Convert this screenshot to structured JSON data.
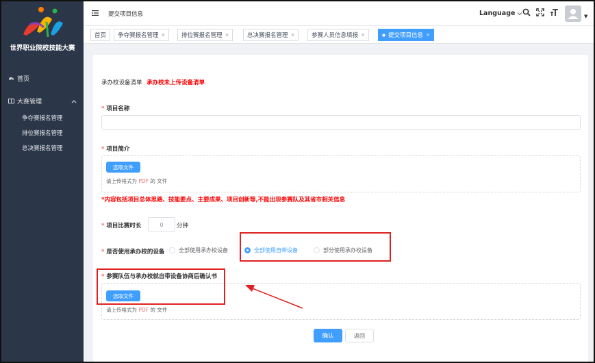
{
  "sidebar": {
    "logo_text": "世界职业院校技能大赛",
    "home_label": "首页",
    "manage_label": "大赛管理",
    "sub_items": [
      "争夺赛报名管理",
      "排位赛报名管理",
      "总决赛报名管理"
    ]
  },
  "header": {
    "breadcrumb": "提交项目信息",
    "language_label": "Language"
  },
  "tabs": [
    {
      "label": "首页",
      "closable": false
    },
    {
      "label": "争夺赛报名管理",
      "closable": true
    },
    {
      "label": "排位赛报名管理",
      "closable": true
    },
    {
      "label": "总决赛报名管理",
      "closable": true
    },
    {
      "label": "参赛人员信息填报",
      "closable": true
    },
    {
      "label": "提交项目信息",
      "closable": true,
      "active": true
    }
  ],
  "tab_close_glyph": "×",
  "form": {
    "equipment_list_label": "承办校设备清单",
    "equipment_list_status": "承办校未上传设备清单",
    "project_name_label": "项目名称",
    "project_name_value": "",
    "project_intro_label": "项目简介",
    "upload_button_label": "选取文件",
    "upload_hint_prefix": "请上传格式为",
    "upload_hint_format": "PDF",
    "upload_hint_suffix": "的 文件",
    "intro_note": "*内容包括项目总体思路、技能要点、主要成果、项目创新等,不能出现参赛队及其省市相关信息",
    "duration_label": "项目比赛时长",
    "duration_value": "0",
    "duration_unit": "分钟",
    "equipment_use_label": "是否使用承办校的设备",
    "equipment_options": [
      {
        "label": "全部使用承办校设备",
        "checked": false
      },
      {
        "label": "全部使用自带设备",
        "checked": true
      },
      {
        "label": "部分使用承办校设备",
        "checked": false
      }
    ],
    "agreement_label": "参赛队伍与承办校就自带设备协商后确认书",
    "confirm_label": "确认",
    "back_label": "返回"
  },
  "colors": {
    "sidebar_bg": "#2b3648",
    "primary": "#409eff",
    "annotation_red": "#e02020",
    "required_red": "#f56c6c"
  }
}
